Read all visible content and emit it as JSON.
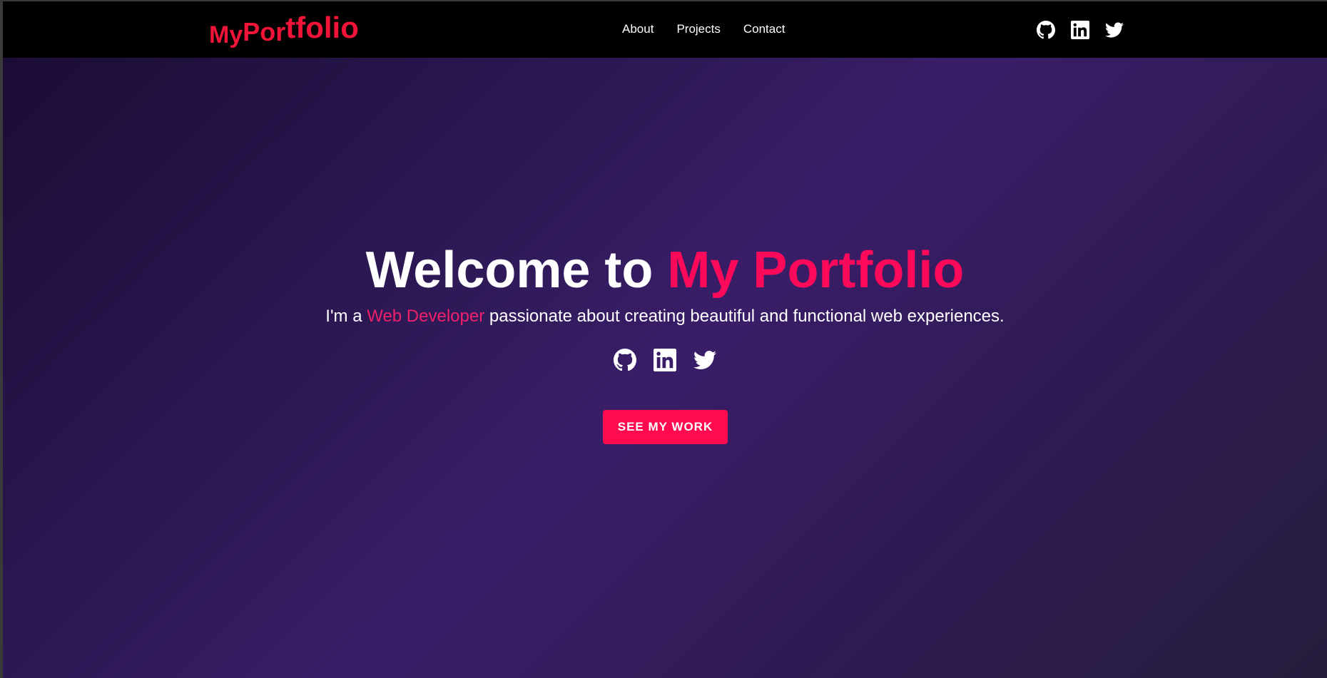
{
  "navbar": {
    "logo": {
      "part1": "My",
      "part2": "Por",
      "part3": "tfolio"
    },
    "links": [
      {
        "label": "About"
      },
      {
        "label": "Projects"
      },
      {
        "label": "Contact"
      }
    ],
    "social_icons": [
      "github-icon",
      "linkedin-icon",
      "twitter-icon"
    ]
  },
  "hero": {
    "title_prefix": "Welcome to ",
    "title_accent": "My Portfolio",
    "subtitle_prefix": "I'm a ",
    "subtitle_accent": "Web Developer",
    "subtitle_suffix": " passionate about creating beautiful and functional web experiences.",
    "social_icons": [
      "github-icon",
      "linkedin-icon",
      "twitter-icon"
    ],
    "cta_label": "SEE MY WORK"
  },
  "colors": {
    "accent": "#ff0a5a",
    "logo": "#f01439",
    "button": "#ff0a4e",
    "navbar_bg": "#000000",
    "hero_bg_dark": "#1b0c35",
    "hero_bg_mid": "#3a1d68"
  }
}
